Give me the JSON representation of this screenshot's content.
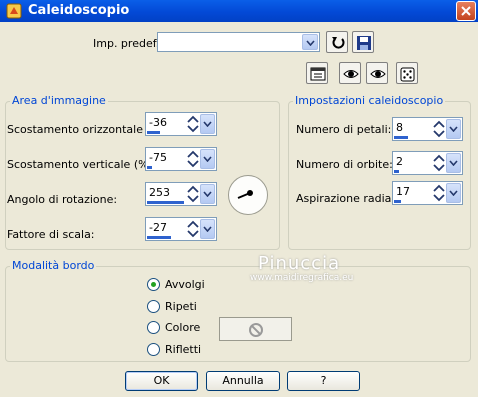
{
  "window": {
    "title": "Caleidoscopio"
  },
  "preset": {
    "label": "Imp. predef.:",
    "value": ""
  },
  "area_immagine": {
    "title": "Area d'immagine",
    "fields": [
      {
        "label": "Scostamento orizzontale (%):",
        "value": "-36",
        "fill_fraction": 0.32
      },
      {
        "label": "Scostamento verticale (%):",
        "value": "-75",
        "fill_fraction": 0.12
      },
      {
        "label": "Angolo di rotazione:",
        "value": "253",
        "fill_fraction": 0.7
      },
      {
        "label": "Fattore di scala:",
        "value": "-27",
        "fill_fraction": 0.36
      }
    ]
  },
  "impostazioni": {
    "title": "Impostazioni caleidoscopio",
    "fields": [
      {
        "label": "Numero di petali:",
        "value": "8",
        "fill_fraction": 0.35
      },
      {
        "label": "Numero di orbite:",
        "value": "2",
        "fill_fraction": 0.12
      },
      {
        "label": "Aspirazione radiale:",
        "value": "17",
        "fill_fraction": 0.17
      }
    ]
  },
  "modalita": {
    "title": "Modalità bordo",
    "options": [
      {
        "label": "Avvolgi",
        "selected": true
      },
      {
        "label": "Ripeti",
        "selected": false
      },
      {
        "label": "Colore",
        "selected": false
      },
      {
        "label": "Rifletti",
        "selected": false
      }
    ]
  },
  "watermark": {
    "name": "Pinuccia",
    "site": "www.maidiregrafica.eu"
  },
  "buttons": {
    "ok": "OK",
    "cancel": "Annulla",
    "help": "?"
  },
  "colors": {
    "accent": "#2E62CE",
    "group_title": "#0046D5",
    "title_bar": "#0349D6",
    "selected_radio": "#21A121"
  }
}
